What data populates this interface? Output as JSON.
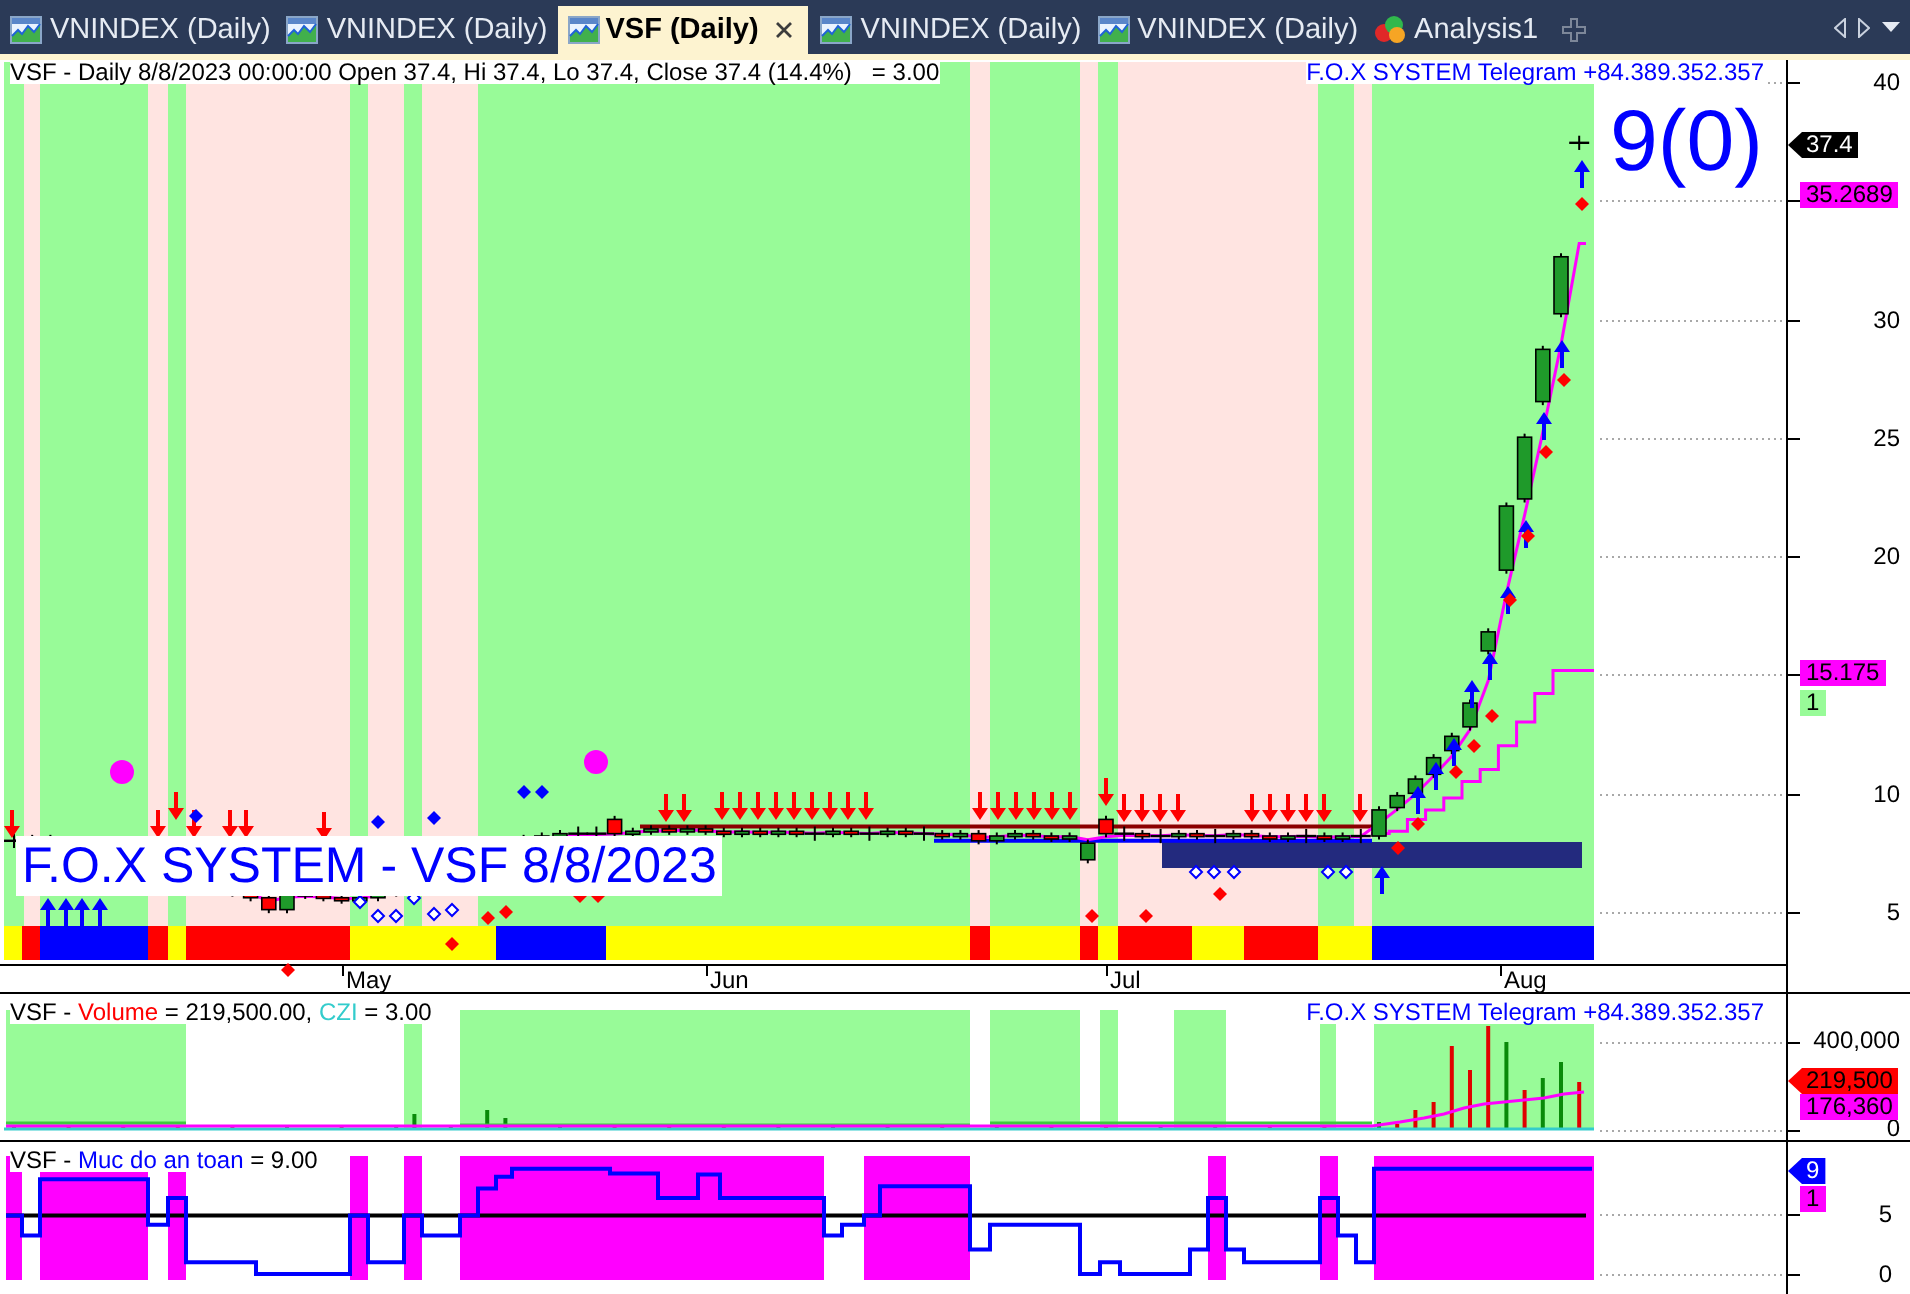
{
  "tabs": [
    {
      "label": "VNINDEX (Daily)",
      "kind": "chart",
      "selected": false
    },
    {
      "label": "VNINDEX (Daily)",
      "kind": "chart",
      "selected": false
    },
    {
      "label": "VSF (Daily)",
      "kind": "chart",
      "selected": true
    },
    {
      "label": "VNINDEX (Daily)",
      "kind": "chart",
      "selected": false
    },
    {
      "label": "VNINDEX (Daily)",
      "kind": "chart",
      "selected": false
    },
    {
      "label": "Analysis1",
      "kind": "analysis",
      "selected": false
    }
  ],
  "price_panel": {
    "legend": "VSF - Daily 8/8/2023 00:00:00 Open 37.4, Hi 37.4, Lo 37.4, Close 37.4 (14.4%)   = 3.00",
    "telegram": "F.O.X SYSTEM Telegram +84.389.352.357",
    "signal_count": "9(0)",
    "banner": "F.O.X SYSTEM - VSF 8/8/2023",
    "axis_ticks": [
      "40",
      "30",
      "25",
      "20",
      "10",
      "5"
    ],
    "value_tags": [
      {
        "text": "37.4",
        "kind": "pointer",
        "color": "#000000"
      },
      {
        "text": "35.2689",
        "kind": "box",
        "color": "#ff00ff"
      },
      {
        "text": "15.175",
        "kind": "box",
        "color": "#ff00ff"
      },
      {
        "text": "1",
        "kind": "box",
        "color": "#98fb98"
      }
    ]
  },
  "time_axis": [
    "May",
    "Jun",
    "Jul",
    "Aug"
  ],
  "volume_panel": {
    "legend": [
      {
        "text": "VSF -",
        "color": "#000000"
      },
      {
        "text": "Volume",
        "color": "#ff0000"
      },
      {
        "text": "= 219,500.00,",
        "color": "#000000"
      },
      {
        "text": "CZI",
        "color": "#33cccc"
      },
      {
        "text": "= 3.00",
        "color": "#000000"
      }
    ],
    "telegram": "F.O.X SYSTEM Telegram +84.389.352.357",
    "axis_ticks": [
      "400,000",
      "0"
    ],
    "value_tags": [
      {
        "text": "219,500",
        "kind": "pointer",
        "color": "#ff0000"
      },
      {
        "text": "176,360",
        "kind": "box",
        "color": "#ff00ff"
      }
    ]
  },
  "safety_panel": {
    "legend": [
      {
        "text": "VSF -",
        "color": "#000000"
      },
      {
        "text": "Muc do an toan",
        "color": "#0000ff"
      },
      {
        "text": "= 9.00",
        "color": "#000000"
      }
    ],
    "axis_ticks": [
      "5",
      "0"
    ],
    "value_tags": [
      {
        "text": "9",
        "kind": "pointer",
        "color": "#0000ff"
      },
      {
        "text": "1",
        "kind": "box",
        "color": "#ff00ff"
      }
    ]
  }
}
